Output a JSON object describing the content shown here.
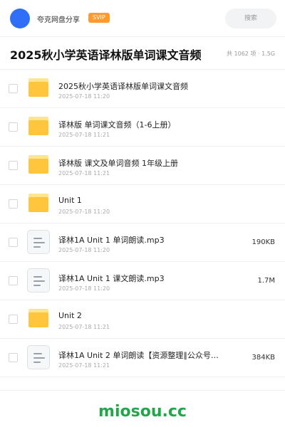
{
  "header": {
    "brand": "夸克网盘分享",
    "badge": "SVIP",
    "search_label": "搜索"
  },
  "folder": {
    "title": "2025秋小学英语译林版单词课文音频",
    "stats": "共 1062 项 · 1.5G"
  },
  "items": [
    {
      "type": "folder",
      "name": "2025秋小学英语译林版单词课文音频",
      "date": "2025-07-18 11:20",
      "size": ""
    },
    {
      "type": "folder",
      "name": "译林版 单词课文音频（1-6上册）",
      "date": "2025-07-18 11:21",
      "size": ""
    },
    {
      "type": "folder",
      "name": "译林版 课文及单词音频 1年级上册",
      "date": "2025-07-18 11:21",
      "size": ""
    },
    {
      "type": "folder",
      "name": "Unit 1",
      "date": "2025-07-18 11:20",
      "size": ""
    },
    {
      "type": "file",
      "name": "译林1A Unit 1 单词朗读.mp3",
      "date": "2025-07-18 11:20",
      "size": "190KB"
    },
    {
      "type": "file",
      "name": "译林1A Unit 1 课文朗读.mp3",
      "date": "2025-07-18 11:20",
      "size": "1.7M"
    },
    {
      "type": "folder",
      "name": "Unit 2",
      "date": "2025-07-18 11:21",
      "size": ""
    },
    {
      "type": "file",
      "name": "译林1A Unit 2 单词朗读【资源整理∥公众号…",
      "date": "2025-07-18 11:21",
      "size": "384KB"
    }
  ],
  "watermark": "miosou.cc",
  "colors": {
    "accent": "#2f6ff7",
    "badge": "#ff9a2e",
    "folder": "#ffc53d",
    "watermark": "#22a64a"
  }
}
